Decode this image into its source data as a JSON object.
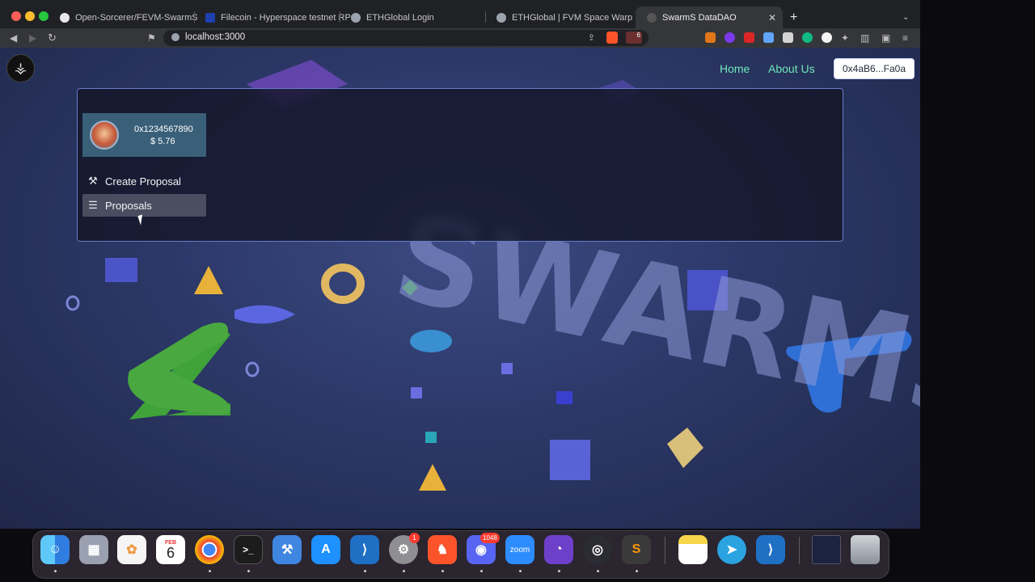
{
  "browser": {
    "tabs": [
      {
        "title": "Open-Sorcerer/FEVM-SwarmS",
        "icon": "github-icon",
        "active": false
      },
      {
        "title": "Filecoin - Hyperspace testnet RPC",
        "icon": "filecoin-icon",
        "active": false
      },
      {
        "title": "ETHGlobal Login",
        "icon": "ethglobal-icon",
        "active": false
      },
      {
        "title": "ETHGlobal | FVM Space Warp",
        "icon": "ethglobal-icon",
        "active": false
      },
      {
        "title": "SwarmS DataDAO",
        "icon": "swarms-icon",
        "active": true
      }
    ],
    "new_tab_label": "+",
    "url": "localhost:3000",
    "brave_badge": "6"
  },
  "page": {
    "nav": {
      "home": "Home",
      "about": "About Us"
    },
    "wallet_button": "0x4aB6...Fa0a",
    "profile": {
      "address": "0x1234567890",
      "balance": "$ 5.76"
    },
    "menu": [
      {
        "label": "Create Proposal",
        "icon": "hammer-icon"
      },
      {
        "label": "Proposals",
        "icon": "list-icon"
      }
    ],
    "background_text": "SWARMS"
  },
  "dock": {
    "apps": [
      {
        "name": "Finder",
        "icon": "finder-icon"
      },
      {
        "name": "Launchpad",
        "icon": "launchpad-icon"
      },
      {
        "name": "Photos",
        "icon": "photos-icon"
      },
      {
        "name": "Calendar",
        "icon": "calendar-icon",
        "month": "FEB",
        "day": "6"
      },
      {
        "name": "Chrome",
        "icon": "chrome-icon"
      },
      {
        "name": "Terminal",
        "icon": "terminal-icon"
      },
      {
        "name": "Xcode",
        "icon": "xcode-icon"
      },
      {
        "name": "App Store",
        "icon": "appstore-icon"
      },
      {
        "name": "VS Code",
        "icon": "vscode-icon"
      },
      {
        "name": "System Settings",
        "icon": "settings-icon",
        "badge": "1"
      },
      {
        "name": "Brave",
        "icon": "brave-icon"
      },
      {
        "name": "Discord",
        "icon": "discord-icon",
        "badge": "1048"
      },
      {
        "name": "Zoom",
        "icon": "zoom-icon",
        "label": "zoom"
      },
      {
        "name": "GitHub Desktop",
        "icon": "github-desktop-icon"
      },
      {
        "name": "OBS",
        "icon": "obs-icon"
      },
      {
        "name": "Sublime Text",
        "icon": "sublime-icon"
      },
      {
        "name": "Notes",
        "icon": "notes-icon"
      },
      {
        "name": "Telegram",
        "icon": "telegram-icon"
      },
      {
        "name": "VS Code",
        "icon": "vscode-icon"
      },
      {
        "name": "Document",
        "icon": "document-icon"
      },
      {
        "name": "Trash",
        "icon": "trash-icon"
      }
    ]
  }
}
